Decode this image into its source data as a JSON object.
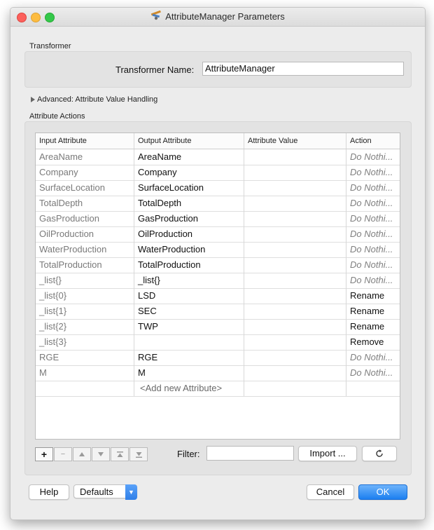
{
  "window": {
    "title": "AttributeManager Parameters"
  },
  "transformer": {
    "section_label": "Transformer",
    "name_label": "Transformer Name:",
    "name_value": "AttributeManager"
  },
  "advanced": {
    "label": "Advanced: Attribute Value Handling"
  },
  "actions": {
    "section_label": "Attribute Actions",
    "columns": [
      "Input Attribute",
      "Output Attribute",
      "Attribute Value",
      "Action"
    ],
    "rows": [
      {
        "input": "AreaName",
        "output": "AreaName",
        "value": "",
        "action": "Do Nothi..."
      },
      {
        "input": "Company",
        "output": "Company",
        "value": "",
        "action": "Do Nothi..."
      },
      {
        "input": "SurfaceLocation",
        "output": "SurfaceLocation",
        "value": "",
        "action": "Do Nothi..."
      },
      {
        "input": "TotalDepth",
        "output": "TotalDepth",
        "value": "",
        "action": "Do Nothi..."
      },
      {
        "input": "GasProduction",
        "output": "GasProduction",
        "value": "",
        "action": "Do Nothi..."
      },
      {
        "input": "OilProduction",
        "output": "OilProduction",
        "value": "",
        "action": "Do Nothi..."
      },
      {
        "input": "WaterProduction",
        "output": "WaterProduction",
        "value": "",
        "action": "Do Nothi..."
      },
      {
        "input": "TotalProduction",
        "output": "TotalProduction",
        "value": "",
        "action": "Do Nothi..."
      },
      {
        "input": "_list{}",
        "output": "_list{}",
        "value": "",
        "action": "Do Nothi..."
      },
      {
        "input": "_list{0}",
        "output": "LSD",
        "value": "",
        "action": "Rename"
      },
      {
        "input": "_list{1}",
        "output": "SEC",
        "value": "",
        "action": "Rename"
      },
      {
        "input": "_list{2}",
        "output": "TWP",
        "value": "",
        "action": "Rename"
      },
      {
        "input": "_list{3}",
        "output": "",
        "value": "",
        "action": "Remove"
      },
      {
        "input": "RGE",
        "output": "RGE",
        "value": "",
        "action": "Do Nothi..."
      },
      {
        "input": "M",
        "output": "M",
        "value": "",
        "action": "Do Nothi..."
      }
    ],
    "add_new_label": "<Add new Attribute>"
  },
  "toolbar": {
    "add_symbol": "+",
    "remove_symbol": "−",
    "move_up_icon": "arrow-up-icon",
    "move_down_icon": "arrow-down-icon",
    "move_top_icon": "arrow-top-icon",
    "move_bottom_icon": "arrow-bottom-icon",
    "filter_label": "Filter:",
    "filter_value": "",
    "import_label": "Import ...",
    "refresh_icon": "refresh-icon"
  },
  "footer": {
    "help_label": "Help",
    "defaults_label": "Defaults",
    "cancel_label": "Cancel",
    "ok_label": "OK"
  }
}
